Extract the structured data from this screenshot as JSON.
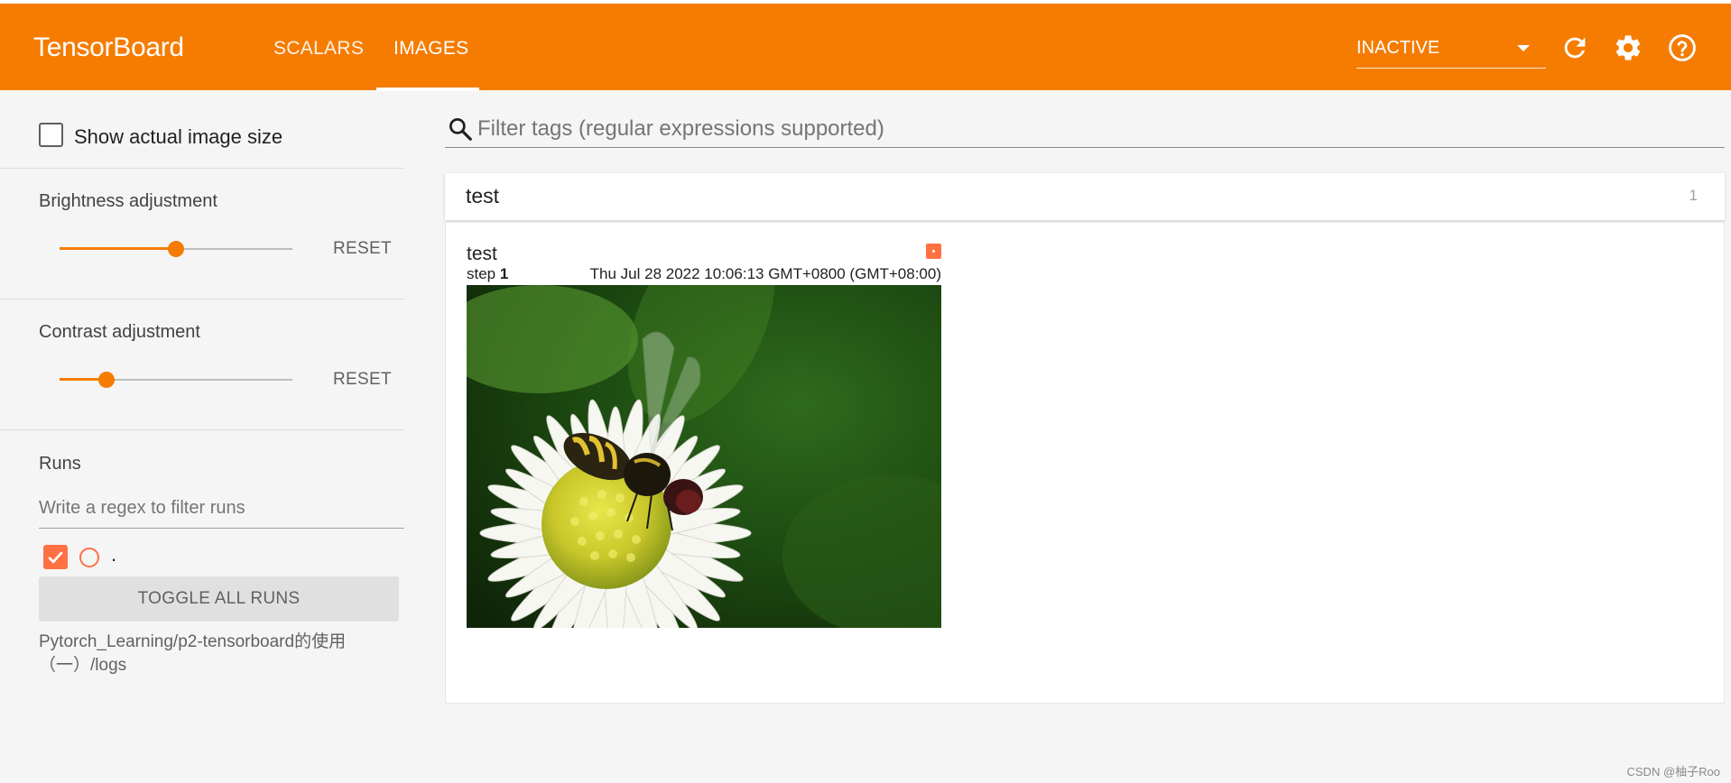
{
  "header": {
    "brand": "TensorBoard",
    "tabs": [
      {
        "label": "SCALARS",
        "active": false
      },
      {
        "label": "IMAGES",
        "active": true
      }
    ],
    "status_select": "INACTIVE",
    "icons": [
      "reload-icon",
      "settings-icon",
      "help-icon"
    ]
  },
  "sidebar": {
    "show_actual_size_label": "Show actual image size",
    "show_actual_size_checked": false,
    "brightness": {
      "label": "Brightness adjustment",
      "value": 0.5,
      "reset_label": "RESET"
    },
    "contrast": {
      "label": "Contrast adjustment",
      "value": 0.2,
      "reset_label": "RESET"
    },
    "runs": {
      "title": "Runs",
      "filter_placeholder": "Write a regex to filter runs",
      "items": [
        {
          "name": ".",
          "checked": true
        }
      ],
      "toggle_label": "TOGGLE ALL RUNS",
      "logdir": "Pytorch_Learning/p2-tensorboard的使用（一）/logs"
    }
  },
  "main": {
    "search_placeholder": "Filter tags (regular expressions supported)",
    "category": {
      "name": "test",
      "count": "1"
    },
    "card": {
      "title": "test",
      "step_label": "step",
      "step_value": "1",
      "timestamp": "Thu Jul 28 2022 10:06:13 GMT+0800 (GMT+08:00)"
    }
  },
  "watermark": "CSDN @柚子Roo",
  "colors": {
    "accent": "#f57c00",
    "run": "#ff7043",
    "header_bg": "#f57c00"
  }
}
